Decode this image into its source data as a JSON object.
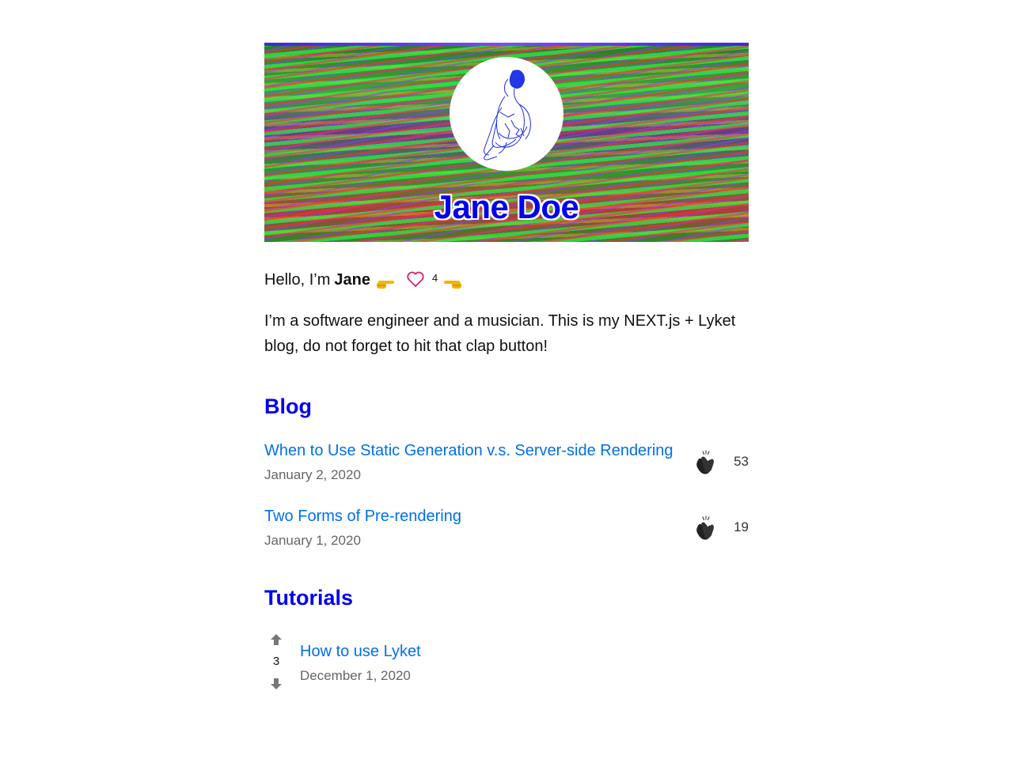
{
  "banner": {
    "name": "Jane Doe"
  },
  "intro": {
    "hello_prefix": "Hello, I’m",
    "hello_name": "Jane",
    "like_count": "4",
    "bio": "I’m a software engineer and a musician. This is my NEXT.js + Lyket blog, do not forget to hit that clap button!"
  },
  "blog": {
    "title": "Blog",
    "posts": [
      {
        "title": "When to Use Static Generation v.s. Server-side Rendering",
        "date": "January 2, 2020",
        "claps": "53"
      },
      {
        "title": "Two Forms of Pre-rendering",
        "date": "January 1, 2020",
        "claps": "19"
      }
    ]
  },
  "tutorials": {
    "title": "Tutorials",
    "items": [
      {
        "title": "How to use Lyket",
        "date": "December 1, 2020",
        "votes": "3"
      }
    ]
  },
  "colors": {
    "heading": "#0000ee",
    "link": "#0070e8",
    "heart": "#e0245e",
    "muted": "#666666"
  },
  "icons": {
    "avatar": "avatar-illustration",
    "pointer_right": "hand-pointing-right-icon",
    "heart": "heart-icon",
    "pointer_left": "hand-pointing-left-icon",
    "clap": "clapping-hands-icon",
    "upvote": "arrow-up-icon",
    "downvote": "arrow-down-icon"
  }
}
